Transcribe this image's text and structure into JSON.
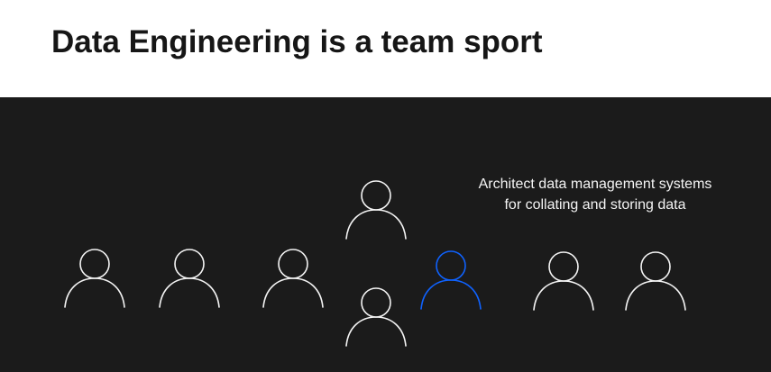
{
  "slide": {
    "title": "Data Engineering is a team sport",
    "caption_lines": [
      "Architect data management systems",
      "for collating and storing data"
    ],
    "people": [
      {
        "name": "person-1-icon",
        "icon": "person-outline-icon",
        "highlighted": false
      },
      {
        "name": "person-2-icon",
        "icon": "person-outline-icon",
        "highlighted": false
      },
      {
        "name": "person-3-icon",
        "icon": "person-outline-icon",
        "highlighted": false
      },
      {
        "name": "person-top-icon",
        "icon": "person-outline-icon",
        "highlighted": false
      },
      {
        "name": "person-bottom-icon",
        "icon": "person-outline-icon",
        "highlighted": false
      },
      {
        "name": "person-highlighted-icon",
        "icon": "person-outline-icon",
        "highlighted": true
      },
      {
        "name": "person-6-icon",
        "icon": "person-outline-icon",
        "highlighted": false
      },
      {
        "name": "person-7-icon",
        "icon": "person-outline-icon",
        "highlighted": false
      }
    ]
  },
  "colors": {
    "background": "#ffffff",
    "panel": "#1b1b1b",
    "title": "#161616",
    "caption": "#f4f4f4",
    "person": "#f4f4f4",
    "highlight": "#0f62fe"
  }
}
